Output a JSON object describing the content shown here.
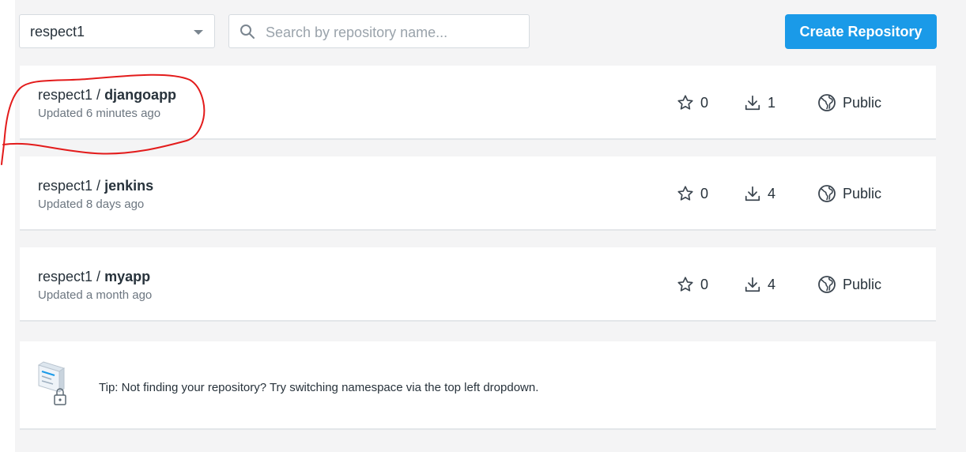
{
  "namespace": {
    "selected": "respect1"
  },
  "search": {
    "placeholder": "Search by repository name..."
  },
  "toolbar": {
    "create_label": "Create Repository"
  },
  "repos": [
    {
      "owner": "respect1",
      "separator": " / ",
      "name": "djangoapp",
      "updated": "Updated 6 minutes ago",
      "stars": "0",
      "pulls": "1",
      "visibility": "Public"
    },
    {
      "owner": "respect1",
      "separator": " / ",
      "name": "jenkins",
      "updated": "Updated 8 days ago",
      "stars": "0",
      "pulls": "4",
      "visibility": "Public"
    },
    {
      "owner": "respect1",
      "separator": " / ",
      "name": "myapp",
      "updated": "Updated a month ago",
      "stars": "0",
      "pulls": "4",
      "visibility": "Public"
    }
  ],
  "tip": {
    "text": "Tip: Not finding your repository? Try switching namespace via the top left dropdown."
  },
  "colors": {
    "primary": "#1a9ae8",
    "annotation": "#e31b1b",
    "background": "#f4f4f5"
  },
  "icons": {
    "search": "search-icon",
    "star": "star-icon",
    "download": "download-icon",
    "globe": "globe-icon",
    "caret": "chevron-down-icon"
  }
}
